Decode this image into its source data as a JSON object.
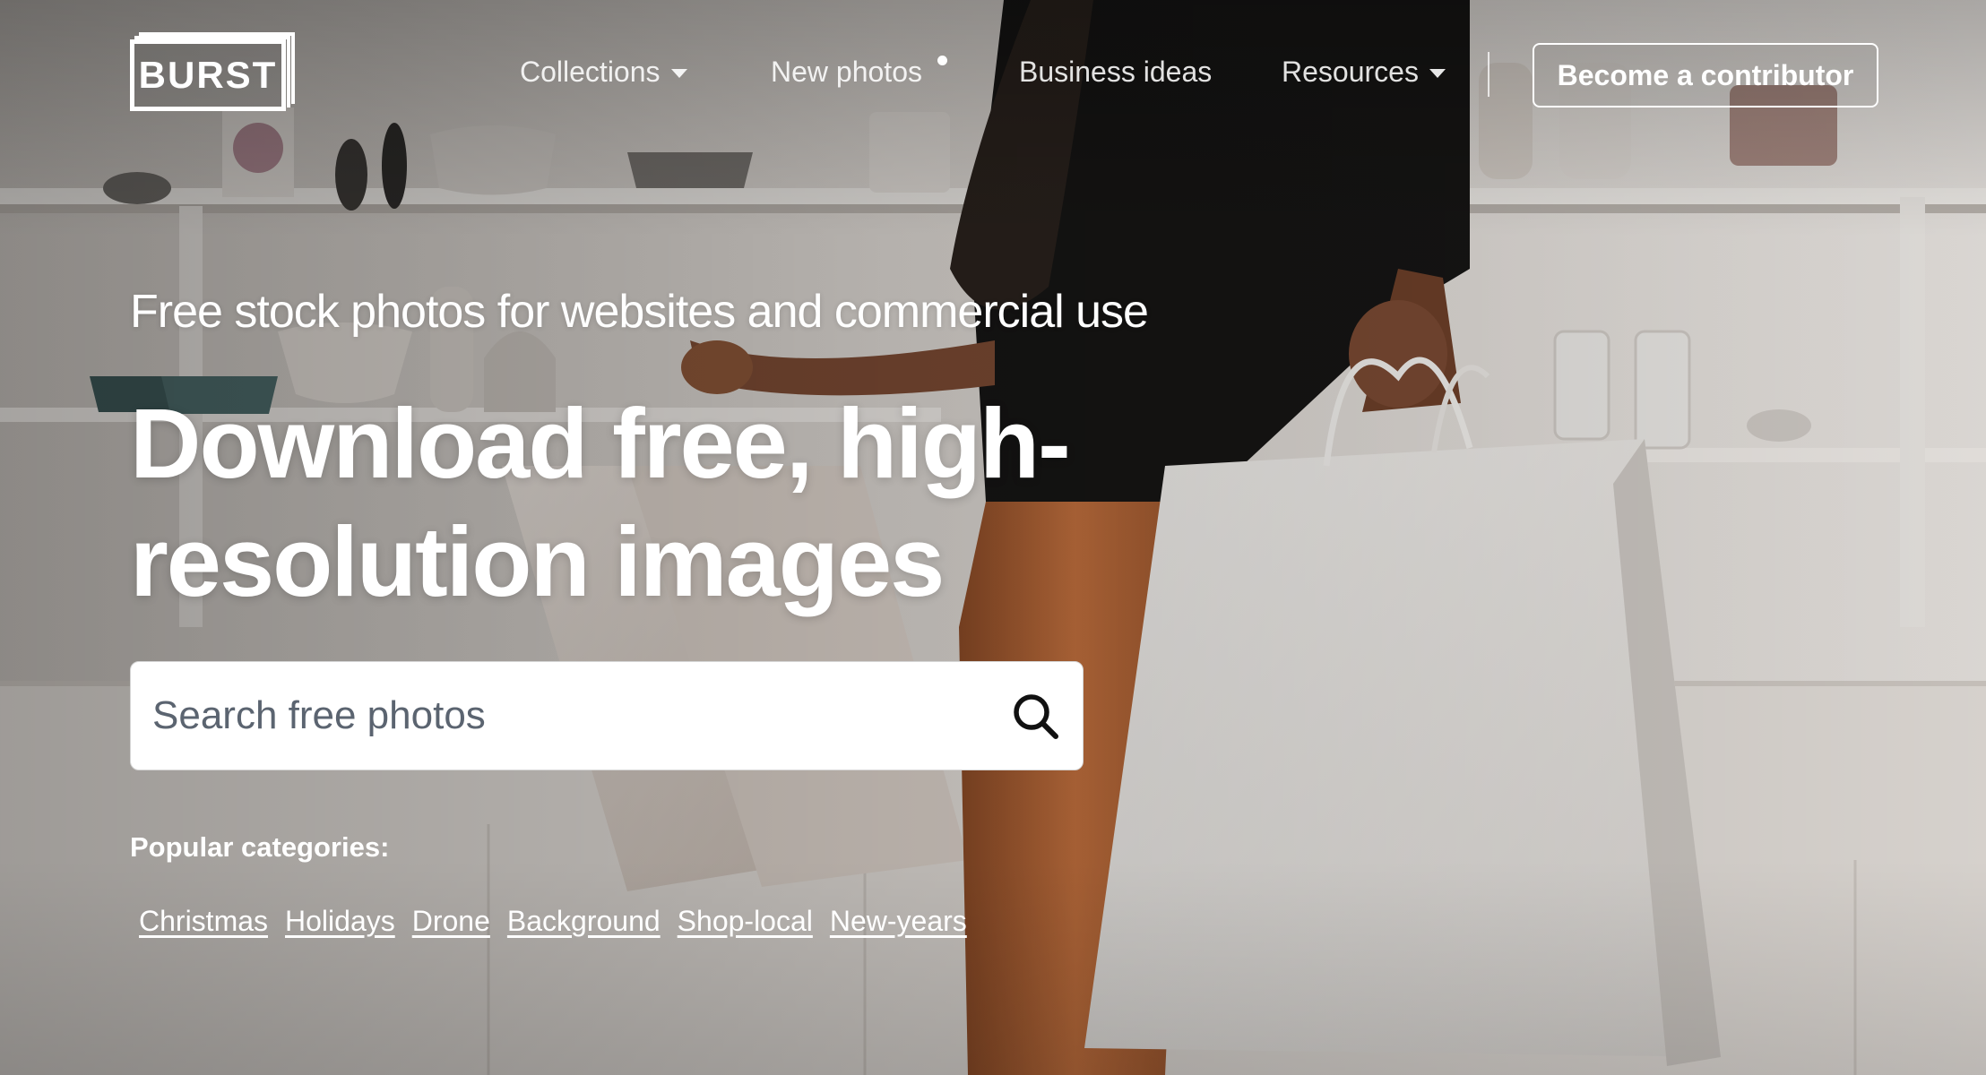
{
  "header": {
    "logo_text": "BURST",
    "nav": [
      {
        "label": "Collections",
        "has_dropdown": true
      },
      {
        "label": "New photos",
        "has_indicator": true
      },
      {
        "label": "Business ideas"
      },
      {
        "label": "Resources",
        "has_dropdown": true
      }
    ],
    "cta_label": "Become a contributor"
  },
  "hero": {
    "tagline": "Free stock photos for websites and commercial use",
    "headline_line1": "Download free, high-",
    "headline_line2": "resolution images",
    "search_placeholder": "Search free photos",
    "popular_label": "Popular categories:",
    "categories": [
      "Christmas",
      "Holidays",
      "Drone",
      "Background",
      "Shop-local",
      "New-years"
    ]
  },
  "icons": {
    "search": "search-icon",
    "caret": "chevron-down-icon"
  },
  "colors": {
    "text": "#ffffff",
    "search_bg": "#ffffff",
    "search_icon": "#111111"
  }
}
